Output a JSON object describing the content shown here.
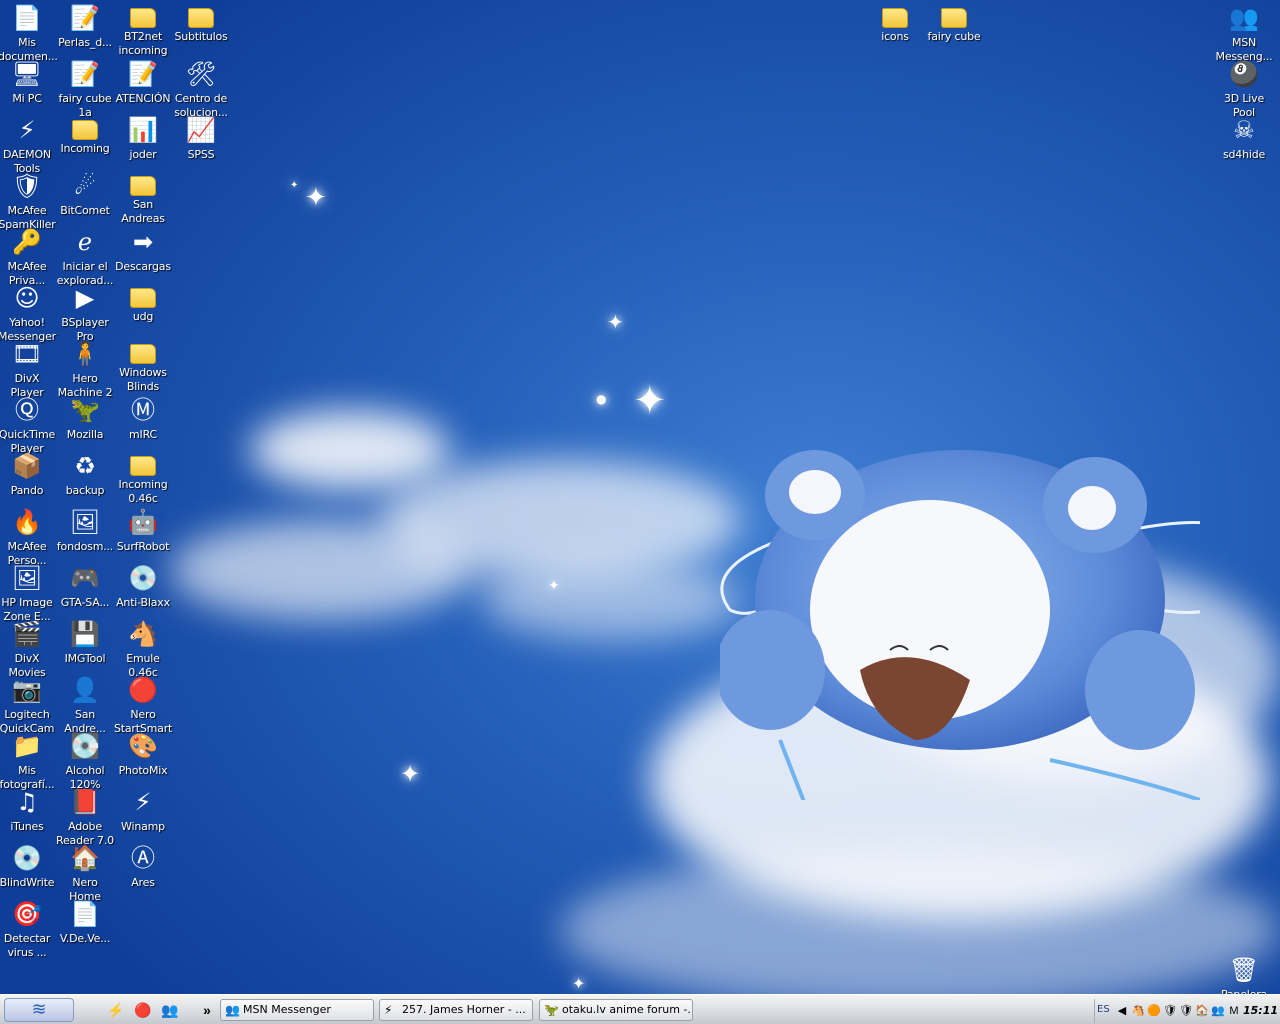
{
  "desktop_icons": [
    {
      "label": "Mis\ndocumen...",
      "glyph": "📄"
    },
    {
      "label": "Perlas_d...",
      "glyph": "📝"
    },
    {
      "label": "BT2net\nincoming",
      "glyph": "folder"
    },
    {
      "label": "Subtitulos",
      "glyph": "folder"
    },
    {
      "label": "icons",
      "glyph": "folder"
    },
    {
      "label": "fairy cube",
      "glyph": "folder"
    },
    {
      "label": "MSN\nMesseng...",
      "glyph": "👥"
    },
    {
      "label": "Mi PC",
      "glyph": "🖥"
    },
    {
      "label": "fairy cube\n1a",
      "glyph": "📝"
    },
    {
      "label": "ATENCIÓN",
      "glyph": "📝"
    },
    {
      "label": "Centro de\nsolucion...",
      "glyph": "🛠"
    },
    {
      "label": "3D Live\nPool",
      "glyph": "🎱"
    },
    {
      "label": "DAEMON\nTools",
      "glyph": "⚡"
    },
    {
      "label": "Incoming",
      "glyph": "folder"
    },
    {
      "label": "joder",
      "glyph": "📊"
    },
    {
      "label": "SPSS",
      "glyph": "📈"
    },
    {
      "label": "sd4hide",
      "glyph": "☠"
    },
    {
      "label": "McAfee\nSpamKiller",
      "glyph": "🛡"
    },
    {
      "label": "BitComet",
      "glyph": "☄"
    },
    {
      "label": "San\nAndreas",
      "glyph": "folder"
    },
    {
      "label": "McAfee\nPriva...",
      "glyph": "🔑"
    },
    {
      "label": "Iniciar el\nexplorad...",
      "glyph": "ℯ"
    },
    {
      "label": "Descargas",
      "glyph": "➡"
    },
    {
      "label": "Yahoo!\nMessenger",
      "glyph": "☺"
    },
    {
      "label": "BSplayer\nPro",
      "glyph": "▶"
    },
    {
      "label": "udg",
      "glyph": "folder"
    },
    {
      "label": "DivX\nPlayer",
      "glyph": "🎞"
    },
    {
      "label": "Hero\nMachine 2",
      "glyph": "🧍"
    },
    {
      "label": "Windows\nBlinds",
      "glyph": "folder"
    },
    {
      "label": "QuickTime\nPlayer",
      "glyph": "Ⓠ"
    },
    {
      "label": "Mozilla",
      "glyph": "🦖"
    },
    {
      "label": "mIRC",
      "glyph": "Ⓜ"
    },
    {
      "label": "Pando",
      "glyph": "📦"
    },
    {
      "label": "backup",
      "glyph": "♻"
    },
    {
      "label": "Incoming\n0.46c",
      "glyph": "folder"
    },
    {
      "label": "McAfee\nPerso...",
      "glyph": "🔥"
    },
    {
      "label": "fondosm...",
      "glyph": "🖼"
    },
    {
      "label": "SurfRobot",
      "glyph": "🤖"
    },
    {
      "label": "HP Image\nZone E...",
      "glyph": "🖼"
    },
    {
      "label": "GTA-SA...",
      "glyph": "🎮"
    },
    {
      "label": "Anti-Blaxx",
      "glyph": "💿"
    },
    {
      "label": "DivX\nMovies",
      "glyph": "🎬"
    },
    {
      "label": "IMGTool",
      "glyph": "💾"
    },
    {
      "label": "Emule\n0.46c",
      "glyph": "🐴"
    },
    {
      "label": "Logitech\nQuickCam",
      "glyph": "📷"
    },
    {
      "label": "San\nAndre...",
      "glyph": "👤"
    },
    {
      "label": "Nero\nStartSmart",
      "glyph": "🔴"
    },
    {
      "label": "Mis\nfotografí...",
      "glyph": "📁"
    },
    {
      "label": "Alcohol\n120%",
      "glyph": "💽"
    },
    {
      "label": "PhotoMix",
      "glyph": "🎨"
    },
    {
      "label": "iTunes",
      "glyph": "♫"
    },
    {
      "label": "Adobe\nReader 7.0",
      "glyph": "📕"
    },
    {
      "label": "Winamp",
      "glyph": "⚡"
    },
    {
      "label": "BlindWrite",
      "glyph": "💿"
    },
    {
      "label": "Nero Home",
      "glyph": "🏠"
    },
    {
      "label": "Ares",
      "glyph": "Ⓐ"
    },
    {
      "label": "Detectar\nvirus ...",
      "glyph": "🎯"
    },
    {
      "label": "V.De.Ve...",
      "glyph": "📄"
    },
    {
      "label": "Papelera",
      "glyph": "🗑"
    }
  ],
  "taskbar": {
    "start_glyph": "≋",
    "quick_launch": [
      "⚡",
      "🔴",
      "👥"
    ],
    "overflow": "»",
    "buttons": [
      {
        "label": "MSN Messenger",
        "glyph": "👥"
      },
      {
        "label": "257. James Horner - ...",
        "glyph": "⚡"
      },
      {
        "label": "otaku.lv anime forum -...",
        "glyph": "🦖"
      }
    ],
    "tray": {
      "language": "ES",
      "icons": [
        "◀",
        "🐴",
        "🟠",
        "🛡",
        "🛡",
        "🏠",
        "👥",
        "M"
      ],
      "clock": "15:11"
    }
  }
}
